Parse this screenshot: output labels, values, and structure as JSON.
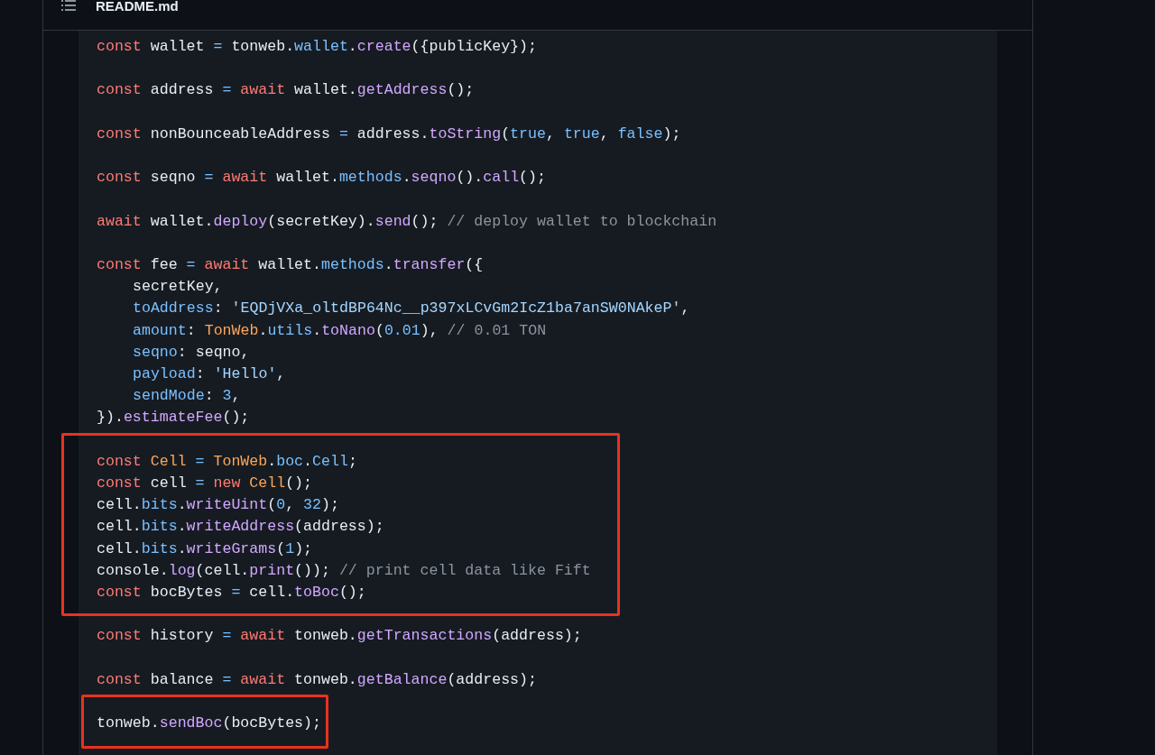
{
  "file_header": {
    "filename": "README.md"
  },
  "code_blocks": [
    {
      "highlighted": false,
      "lines": [
        {
          "indent": false,
          "tokens": [
            {
              "kind": "kw",
              "text": "const"
            },
            {
              "kind": "plain",
              "text": " wallet "
            },
            {
              "kind": "op",
              "text": "="
            },
            {
              "kind": "plain",
              "text": " tonweb."
            },
            {
              "kind": "prop",
              "text": "wallet"
            },
            {
              "kind": "plain",
              "text": "."
            },
            {
              "kind": "fn",
              "text": "create"
            },
            {
              "kind": "plain",
              "text": "({publicKey});"
            }
          ]
        }
      ]
    },
    {
      "highlighted": false,
      "lines": [
        {
          "indent": false,
          "tokens": [
            {
              "kind": "kw",
              "text": "const"
            },
            {
              "kind": "plain",
              "text": " address "
            },
            {
              "kind": "op",
              "text": "= "
            },
            {
              "kind": "kw",
              "text": "await"
            },
            {
              "kind": "plain",
              "text": " wallet."
            },
            {
              "kind": "fn",
              "text": "getAddress"
            },
            {
              "kind": "plain",
              "text": "();"
            }
          ]
        }
      ]
    },
    {
      "highlighted": false,
      "lines": [
        {
          "indent": false,
          "tokens": [
            {
              "kind": "kw",
              "text": "const"
            },
            {
              "kind": "plain",
              "text": " nonBounceableAddress "
            },
            {
              "kind": "op",
              "text": "="
            },
            {
              "kind": "plain",
              "text": " address."
            },
            {
              "kind": "fn",
              "text": "toString"
            },
            {
              "kind": "plain",
              "text": "("
            },
            {
              "kind": "num",
              "text": "true"
            },
            {
              "kind": "plain",
              "text": ", "
            },
            {
              "kind": "num",
              "text": "true"
            },
            {
              "kind": "plain",
              "text": ", "
            },
            {
              "kind": "num",
              "text": "false"
            },
            {
              "kind": "plain",
              "text": ");"
            }
          ]
        }
      ]
    },
    {
      "highlighted": false,
      "lines": [
        {
          "indent": false,
          "tokens": [
            {
              "kind": "kw",
              "text": "const"
            },
            {
              "kind": "plain",
              "text": " seqno "
            },
            {
              "kind": "op",
              "text": "= "
            },
            {
              "kind": "kw",
              "text": "await"
            },
            {
              "kind": "plain",
              "text": " wallet."
            },
            {
              "kind": "prop",
              "text": "methods"
            },
            {
              "kind": "plain",
              "text": "."
            },
            {
              "kind": "fn",
              "text": "seqno"
            },
            {
              "kind": "plain",
              "text": "()."
            },
            {
              "kind": "fn",
              "text": "call"
            },
            {
              "kind": "plain",
              "text": "();"
            }
          ]
        }
      ]
    },
    {
      "highlighted": false,
      "lines": [
        {
          "indent": false,
          "tokens": [
            {
              "kind": "kw",
              "text": "await"
            },
            {
              "kind": "plain",
              "text": " wallet."
            },
            {
              "kind": "fn",
              "text": "deploy"
            },
            {
              "kind": "plain",
              "text": "(secretKey)."
            },
            {
              "kind": "fn",
              "text": "send"
            },
            {
              "kind": "plain",
              "text": "(); "
            },
            {
              "kind": "comment",
              "text": "// deploy wallet to blockchain"
            }
          ]
        }
      ]
    },
    {
      "highlighted": false,
      "lines": [
        {
          "indent": false,
          "tokens": [
            {
              "kind": "kw",
              "text": "const"
            },
            {
              "kind": "plain",
              "text": " fee "
            },
            {
              "kind": "op",
              "text": "= "
            },
            {
              "kind": "kw",
              "text": "await"
            },
            {
              "kind": "plain",
              "text": " wallet."
            },
            {
              "kind": "prop",
              "text": "methods"
            },
            {
              "kind": "plain",
              "text": "."
            },
            {
              "kind": "fn",
              "text": "transfer"
            },
            {
              "kind": "plain",
              "text": "({"
            }
          ]
        },
        {
          "indent": true,
          "tokens": [
            {
              "kind": "plain",
              "text": "secretKey,"
            }
          ]
        },
        {
          "indent": true,
          "tokens": [
            {
              "kind": "prop",
              "text": "toAddress"
            },
            {
              "kind": "plain",
              "text": ": "
            },
            {
              "kind": "str",
              "text": "'EQDjVXa_oltdBP64Nc__p397xLCvGm2IcZ1ba7anSW0NAkeP'"
            },
            {
              "kind": "plain",
              "text": ","
            }
          ]
        },
        {
          "indent": true,
          "tokens": [
            {
              "kind": "prop",
              "text": "amount"
            },
            {
              "kind": "plain",
              "text": ": "
            },
            {
              "kind": "cls",
              "text": "TonWeb"
            },
            {
              "kind": "plain",
              "text": "."
            },
            {
              "kind": "prop",
              "text": "utils"
            },
            {
              "kind": "plain",
              "text": "."
            },
            {
              "kind": "fn",
              "text": "toNano"
            },
            {
              "kind": "plain",
              "text": "("
            },
            {
              "kind": "num",
              "text": "0.01"
            },
            {
              "kind": "plain",
              "text": "), "
            },
            {
              "kind": "comment",
              "text": "// 0.01 TON"
            }
          ]
        },
        {
          "indent": true,
          "tokens": [
            {
              "kind": "prop",
              "text": "seqno"
            },
            {
              "kind": "plain",
              "text": ": seqno,"
            }
          ]
        },
        {
          "indent": true,
          "tokens": [
            {
              "kind": "prop",
              "text": "payload"
            },
            {
              "kind": "plain",
              "text": ": "
            },
            {
              "kind": "str",
              "text": "'Hello'"
            },
            {
              "kind": "plain",
              "text": ","
            }
          ]
        },
        {
          "indent": true,
          "tokens": [
            {
              "kind": "prop",
              "text": "sendMode"
            },
            {
              "kind": "plain",
              "text": ": "
            },
            {
              "kind": "num",
              "text": "3"
            },
            {
              "kind": "plain",
              "text": ","
            }
          ]
        },
        {
          "indent": false,
          "tokens": [
            {
              "kind": "plain",
              "text": "})."
            },
            {
              "kind": "fn",
              "text": "estimateFee"
            },
            {
              "kind": "plain",
              "text": "();"
            }
          ]
        }
      ]
    },
    {
      "highlighted": true,
      "lines": [
        {
          "indent": false,
          "tokens": [
            {
              "kind": "kw",
              "text": "const "
            },
            {
              "kind": "cls",
              "text": "Cell "
            },
            {
              "kind": "op",
              "text": "= "
            },
            {
              "kind": "cls",
              "text": "TonWeb"
            },
            {
              "kind": "plain",
              "text": "."
            },
            {
              "kind": "prop",
              "text": "boc"
            },
            {
              "kind": "plain",
              "text": "."
            },
            {
              "kind": "prop",
              "text": "Cell"
            },
            {
              "kind": "plain",
              "text": ";"
            }
          ]
        },
        {
          "indent": false,
          "tokens": [
            {
              "kind": "kw",
              "text": "const"
            },
            {
              "kind": "plain",
              "text": " cell "
            },
            {
              "kind": "op",
              "text": "= "
            },
            {
              "kind": "kw",
              "text": "new "
            },
            {
              "kind": "cls",
              "text": "Cell"
            },
            {
              "kind": "plain",
              "text": "();"
            }
          ]
        },
        {
          "indent": false,
          "tokens": [
            {
              "kind": "plain",
              "text": "cell."
            },
            {
              "kind": "prop",
              "text": "bits"
            },
            {
              "kind": "plain",
              "text": "."
            },
            {
              "kind": "fn",
              "text": "writeUint"
            },
            {
              "kind": "plain",
              "text": "("
            },
            {
              "kind": "num",
              "text": "0"
            },
            {
              "kind": "plain",
              "text": ", "
            },
            {
              "kind": "num",
              "text": "32"
            },
            {
              "kind": "plain",
              "text": ");"
            }
          ]
        },
        {
          "indent": false,
          "tokens": [
            {
              "kind": "plain",
              "text": "cell."
            },
            {
              "kind": "prop",
              "text": "bits"
            },
            {
              "kind": "plain",
              "text": "."
            },
            {
              "kind": "fn",
              "text": "writeAddress"
            },
            {
              "kind": "plain",
              "text": "(address);"
            }
          ]
        },
        {
          "indent": false,
          "tokens": [
            {
              "kind": "plain",
              "text": "cell."
            },
            {
              "kind": "prop",
              "text": "bits"
            },
            {
              "kind": "plain",
              "text": "."
            },
            {
              "kind": "fn",
              "text": "writeGrams"
            },
            {
              "kind": "plain",
              "text": "("
            },
            {
              "kind": "num",
              "text": "1"
            },
            {
              "kind": "plain",
              "text": ");"
            }
          ]
        },
        {
          "indent": false,
          "tokens": [
            {
              "kind": "plain",
              "text": "console."
            },
            {
              "kind": "fn",
              "text": "log"
            },
            {
              "kind": "plain",
              "text": "(cell."
            },
            {
              "kind": "fn",
              "text": "print"
            },
            {
              "kind": "plain",
              "text": "()); "
            },
            {
              "kind": "comment",
              "text": "// print cell data like Fift"
            }
          ]
        },
        {
          "indent": false,
          "tokens": [
            {
              "kind": "kw",
              "text": "const"
            },
            {
              "kind": "plain",
              "text": " bocBytes "
            },
            {
              "kind": "op",
              "text": "="
            },
            {
              "kind": "plain",
              "text": " cell."
            },
            {
              "kind": "fn",
              "text": "toBoc"
            },
            {
              "kind": "plain",
              "text": "();"
            }
          ]
        }
      ]
    },
    {
      "highlighted": false,
      "lines": [
        {
          "indent": false,
          "tokens": [
            {
              "kind": "kw",
              "text": "const"
            },
            {
              "kind": "plain",
              "text": " history "
            },
            {
              "kind": "op",
              "text": "= "
            },
            {
              "kind": "kw",
              "text": "await"
            },
            {
              "kind": "plain",
              "text": " tonweb."
            },
            {
              "kind": "fn",
              "text": "getTransactions"
            },
            {
              "kind": "plain",
              "text": "(address);"
            }
          ]
        }
      ]
    },
    {
      "highlighted": false,
      "lines": [
        {
          "indent": false,
          "tokens": [
            {
              "kind": "kw",
              "text": "const"
            },
            {
              "kind": "plain",
              "text": " balance "
            },
            {
              "kind": "op",
              "text": "= "
            },
            {
              "kind": "kw",
              "text": "await"
            },
            {
              "kind": "plain",
              "text": " tonweb."
            },
            {
              "kind": "fn",
              "text": "getBalance"
            },
            {
              "kind": "plain",
              "text": "(address);"
            }
          ]
        }
      ]
    },
    {
      "highlighted": true,
      "lines": [
        {
          "indent": false,
          "tokens": [
            {
              "kind": "plain",
              "text": "tonweb."
            },
            {
              "kind": "fn",
              "text": "sendBoc"
            },
            {
              "kind": "plain",
              "text": "(bocBytes);"
            }
          ]
        }
      ]
    }
  ]
}
